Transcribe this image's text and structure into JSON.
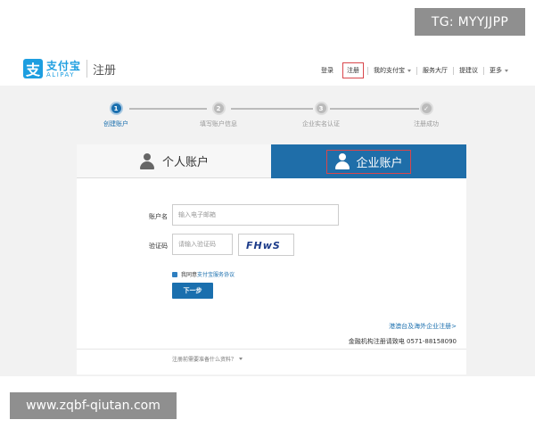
{
  "watermarks": {
    "top": "TG: MYYJJPP",
    "bottom": "www.zqbf-qiutan.com"
  },
  "header": {
    "logo_glyph": "支",
    "brand_cn": "支付宝",
    "brand_en": "ALIPAY",
    "page_title": "注册",
    "nav": {
      "login": "登录",
      "register": "注册",
      "my_alipay": "我的支付宝",
      "service_hall": "服务大厅",
      "suggestions": "提建议",
      "more": "更多"
    }
  },
  "steps": [
    {
      "num": "1",
      "label": "创建账户"
    },
    {
      "num": "2",
      "label": "填写账户信息"
    },
    {
      "num": "3",
      "label": "企业实名认证"
    },
    {
      "num": "✓",
      "label": "注册成功"
    }
  ],
  "tabs": {
    "personal": "个人账户",
    "enterprise": "企业账户"
  },
  "form": {
    "account_label": "账户名",
    "account_placeholder": "输入电子邮箱",
    "captcha_label": "验证码",
    "captcha_placeholder": "请输入验证码",
    "captcha_text": "FHwS",
    "agree_prefix": "我同意",
    "agree_link": "支付宝服务协议",
    "next_button": "下一步"
  },
  "footer": {
    "foreign_link": "港澳台及海外企业注册>",
    "phone": "金融机构注册请致电 0571-88158090",
    "prep": "注册前需要准备什么资料？"
  },
  "colors": {
    "primary": "#1a6fae",
    "highlight_border": "#d9464b",
    "brand": "#1d9ee0"
  }
}
